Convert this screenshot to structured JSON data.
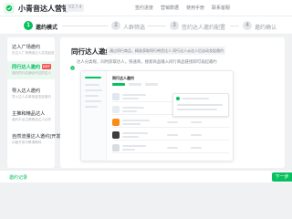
{
  "app": {
    "title": "小青音达人营销",
    "version_tag": "V2.7.4",
    "top_links": [
      "签约进度",
      "营销数据",
      "使用手册",
      "联系客服"
    ]
  },
  "steps": [
    {
      "number": "1",
      "label": "邀约模式",
      "state": "active"
    },
    {
      "number": "2",
      "label": "人群筛选",
      "state": "idle"
    },
    {
      "number": "3",
      "label": "签约达人邀约配置",
      "state": "idle"
    },
    {
      "number": "4",
      "label": "邀约确认",
      "state": "idle"
    }
  ],
  "sidebar": {
    "items": [
      {
        "title": "达人广场邀约",
        "subtitle": "在达人广场筛选达人并发起邀约",
        "active": false,
        "badge": ""
      },
      {
        "title": "同行达人邀约",
        "subtitle": "邀约同行店铺合作过的达人",
        "active": true,
        "badge": "HOT"
      },
      {
        "title": "导入达人邀约",
        "subtitle": "导入达人名单批量发起邀约",
        "active": false,
        "badge": ""
      },
      {
        "title": "主推和精品达人",
        "subtitle": "邀约平台主推精品达人合作",
        "active": false,
        "badge": ""
      },
      {
        "title": "自然流量达人邀约(开发中)",
        "subtitle": "功能开发中敬请期待",
        "active": false,
        "badge": ""
      }
    ]
  },
  "main": {
    "title": "同行达人邀约",
    "chip": "通过同行商品，精准获取同行带货达人 同行达人@达人后自动发起邀约",
    "description": "达人分类呢，同时获取达人，快速商，搜索商品输入同行商品链接即可发起邀约"
  },
  "preview": {
    "header": "同行达人邀约"
  },
  "footer": {
    "invite_record": "邀约记录",
    "next_label": "下一步"
  },
  "colors": {
    "accent": "#07c160",
    "badge": "#fa5151"
  }
}
